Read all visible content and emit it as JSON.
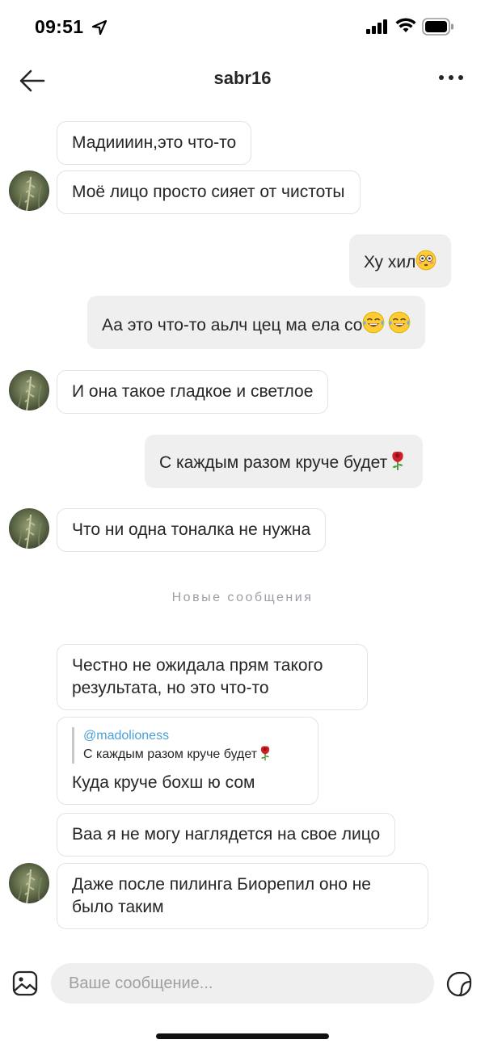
{
  "status_bar": {
    "time": "09:51"
  },
  "header": {
    "title": "sabr16",
    "back_icon": "arrow-left-icon",
    "more_icon": "more-dots-icon"
  },
  "messages": [
    {
      "from": "them",
      "text": "Мадиииин,это что-то"
    },
    {
      "from": "them",
      "text": "Моё  лицо просто сияет от чистоты"
    },
    {
      "from": "me",
      "text": "Ху хил",
      "emoji": "flushed-face"
    },
    {
      "from": "me",
      "text": "Аа это что-то аьлч цец ма ела со",
      "emoji": "tears-of-joy x2"
    },
    {
      "from": "them",
      "text": "И она  такое гладкое и светлое"
    },
    {
      "from": "me",
      "text": "С каждым разом круче будет",
      "emoji": "rose"
    },
    {
      "from": "them",
      "text": "Что  ни одна тоналка не нужна"
    }
  ],
  "separator": "Новые сообщения",
  "new_messages": [
    {
      "from": "them",
      "text": "Честно не ожидала прям такого результата, но это  что-то"
    },
    {
      "from": "them",
      "reply": {
        "mention": "@madolioness",
        "quoted_text": "С каждым разом круче будет",
        "quoted_emoji": "rose"
      },
      "text": "Куда  круче бохш ю сом"
    },
    {
      "from": "them",
      "text": "Ваа я не могу   наглядется на свое лицо"
    },
    {
      "from": "them",
      "text": "Даже после пилинга Биорепил оно  не было  таким"
    }
  ],
  "composer": {
    "placeholder": "Ваше сообщение...",
    "gallery_icon": "image-gallery-icon",
    "sticker_icon": "sticker-icon"
  },
  "colors": {
    "mention": "#4a9fd8",
    "outgoing_bubble": "#efefef",
    "incoming_border": "#e3e3e3",
    "separator": "#9aa0a6"
  }
}
